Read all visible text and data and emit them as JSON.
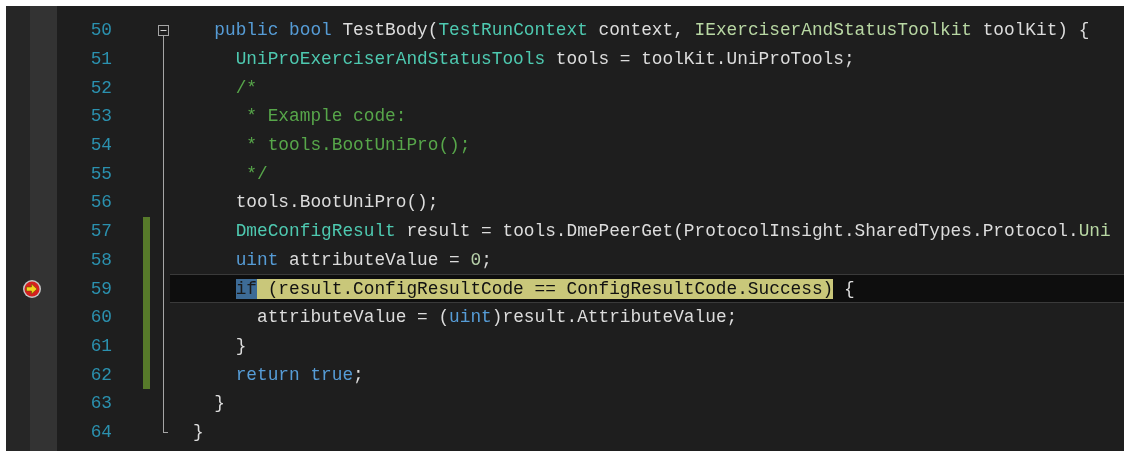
{
  "editor": {
    "lines": [
      {
        "number": "50",
        "current": false,
        "changed": false,
        "kind": "fold-start",
        "tokens": [
          {
            "kind": "keyword",
            "text": "  public bool "
          },
          {
            "kind": "plain",
            "text": "TestBody("
          },
          {
            "kind": "type",
            "text": "TestRunContext"
          },
          {
            "kind": "plain",
            "text": " context, "
          },
          {
            "kind": "interface",
            "text": "IExerciserAndStatusToolkit"
          },
          {
            "kind": "plain",
            "text": " toolKit) {"
          }
        ]
      },
      {
        "number": "51",
        "current": false,
        "changed": false,
        "kind": "fold-body",
        "tokens": [
          {
            "kind": "type",
            "text": "    UniProExerciserAndStatusTools"
          },
          {
            "kind": "plain",
            "text": " tools = toolKit.UniProTools;"
          }
        ]
      },
      {
        "number": "52",
        "current": false,
        "changed": false,
        "kind": "fold-body",
        "tokens": [
          {
            "kind": "comment",
            "text": "    /*"
          }
        ]
      },
      {
        "number": "53",
        "current": false,
        "changed": false,
        "kind": "fold-body",
        "tokens": [
          {
            "kind": "comment",
            "text": "     * Example code:"
          }
        ]
      },
      {
        "number": "54",
        "current": false,
        "changed": false,
        "kind": "fold-body",
        "tokens": [
          {
            "kind": "comment",
            "text": "     * tools.BootUniPro();"
          }
        ]
      },
      {
        "number": "55",
        "current": false,
        "changed": false,
        "kind": "fold-body",
        "tokens": [
          {
            "kind": "comment",
            "text": "     */"
          }
        ]
      },
      {
        "number": "56",
        "current": false,
        "changed": false,
        "kind": "fold-body",
        "tokens": [
          {
            "kind": "plain",
            "text": "    tools.BootUniPro();"
          }
        ]
      },
      {
        "number": "57",
        "current": false,
        "changed": true,
        "kind": "fold-body",
        "tokens": [
          {
            "kind": "type",
            "text": "    DmeConfigResult"
          },
          {
            "kind": "plain",
            "text": " result = tools.DmePeerGet(ProtocolInsight.SharedTypes.Protocol."
          },
          {
            "kind": "interface",
            "text": "Uni"
          }
        ]
      },
      {
        "number": "58",
        "current": false,
        "changed": true,
        "kind": "fold-body",
        "tokens": [
          {
            "kind": "keyword",
            "text": "    uint"
          },
          {
            "kind": "plain",
            "text": " attributeValue = "
          },
          {
            "kind": "number",
            "text": "0"
          },
          {
            "kind": "plain",
            "text": ";"
          }
        ]
      },
      {
        "number": "59",
        "current": true,
        "changed": true,
        "kind": "fold-body",
        "tokens": [
          {
            "kind": "selected-text",
            "text": "    if"
          },
          {
            "kind": "current-statement",
            "text": " (result.ConfigResultCode == ConfigResultCode.Success)"
          },
          {
            "kind": "plain",
            "text": " {"
          }
        ]
      },
      {
        "number": "60",
        "current": false,
        "changed": true,
        "kind": "fold-body",
        "tokens": [
          {
            "kind": "plain",
            "text": "      attributeValue = ("
          },
          {
            "kind": "keyword",
            "text": "uint"
          },
          {
            "kind": "plain",
            "text": ")result.AttributeValue;"
          }
        ]
      },
      {
        "number": "61",
        "current": false,
        "changed": true,
        "kind": "fold-body",
        "tokens": [
          {
            "kind": "plain",
            "text": "    }"
          }
        ]
      },
      {
        "number": "62",
        "current": false,
        "changed": true,
        "kind": "fold-body",
        "tokens": [
          {
            "kind": "keyword",
            "text": "    return true"
          },
          {
            "kind": "plain",
            "text": ";"
          }
        ]
      },
      {
        "number": "63",
        "current": false,
        "changed": false,
        "kind": "fold-body",
        "tokens": [
          {
            "kind": "plain",
            "text": "  }"
          }
        ]
      },
      {
        "number": "64",
        "current": false,
        "changed": false,
        "kind": "fold-end",
        "tokens": [
          {
            "kind": "plain",
            "text": "}"
          }
        ]
      }
    ]
  }
}
